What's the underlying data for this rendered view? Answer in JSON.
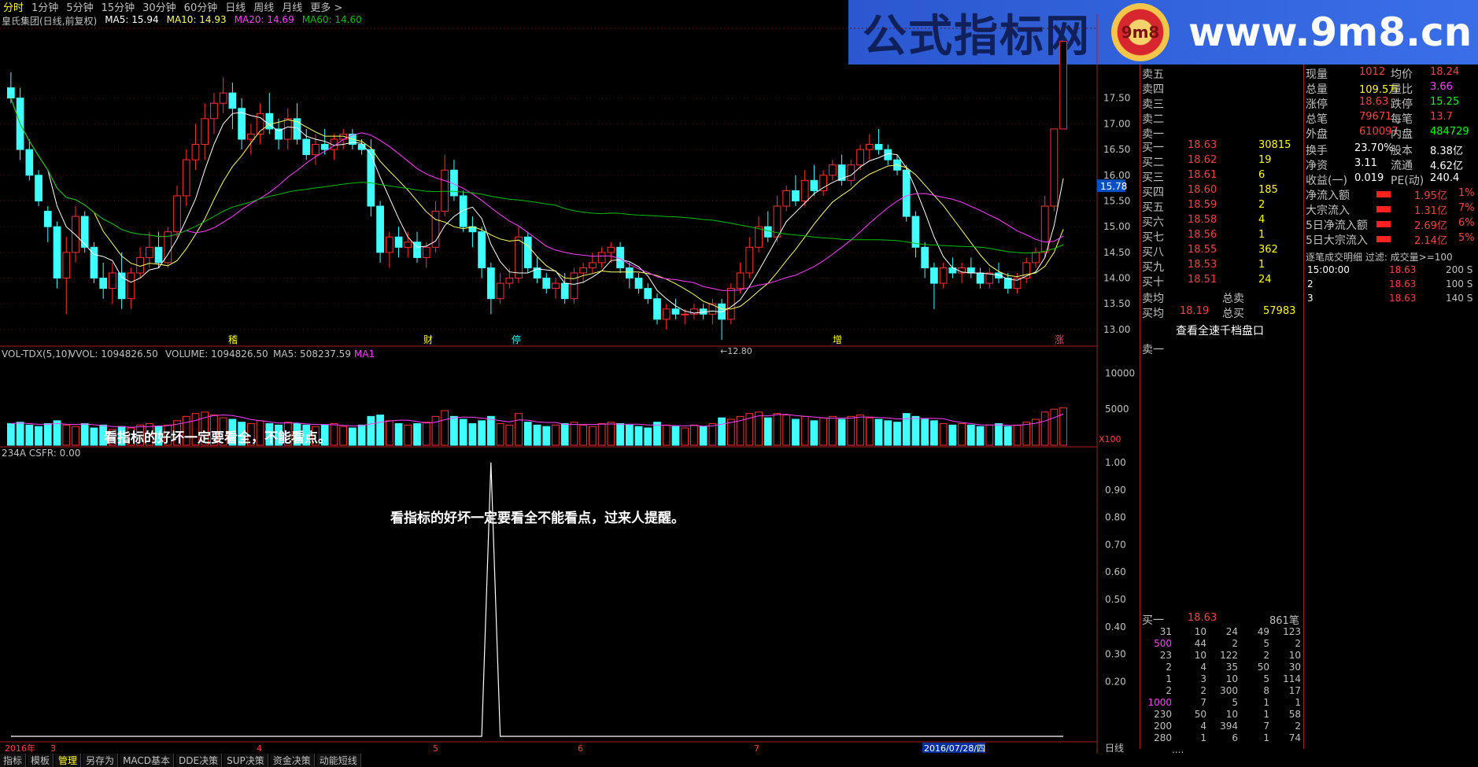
{
  "period_tabs": [
    "分时",
    "1分钟",
    "5分钟",
    "15分钟",
    "30分钟",
    "60分钟",
    "日线",
    "周线",
    "月线",
    "更多 >"
  ],
  "active_tab": "分时",
  "info": {
    "stock": "皇氏集团(日线,前复权)",
    "ma5": "MA5: 15.94",
    "ma10": "MA10: 14.93",
    "ma20": "MA20: 14.69",
    "ma60": "MA60: 14.60"
  },
  "banner": {
    "title": "公式指标网",
    "logo": "9m8",
    "url": "www.9m8.cn"
  },
  "price_axis": [
    "17.50",
    "17.00",
    "16.50",
    "16.00",
    "15.50",
    "15.00",
    "14.50",
    "14.00",
    "13.50",
    "13.00"
  ],
  "current_price_marker": "15.78",
  "low_label": "←12.80",
  "event_marks": [
    "稽",
    "财",
    "停",
    "增",
    "涨"
  ],
  "vol_header": {
    "name": "VOL-TDX(5,10)",
    "vvol": "VVOL: 1094826.50",
    "volume": "VOLUME: 1094826.50",
    "ma5": "MA5: 508237.59",
    "ma1": "MA1"
  },
  "vol_axis": [
    "10000",
    "5000"
  ],
  "vol_unit": "X100",
  "vol_note": "看指标的好坏一定要看全，不能看点。",
  "ind_header": "234A  CSFR: 0.00",
  "ind_axis": [
    "1.00",
    "0.90",
    "0.80",
    "0.70",
    "0.60",
    "0.50",
    "0.40",
    "0.30",
    "0.20"
  ],
  "ind_note": "看指标的好坏一定要看全不能看点，过来人提醒。",
  "date_bar": {
    "year": "2016年",
    "months": [
      "3",
      "4",
      "5",
      "6",
      "7"
    ],
    "highlight": "2016/07/28/四",
    "right": "日线"
  },
  "bottom_tabs": [
    "指标",
    "模板",
    "管理",
    "另存为",
    "MACD基本",
    "DDE决策",
    "SUP决策",
    "资金决策",
    "动能短线"
  ],
  "active_bottom_tab": "管理",
  "sell_levels": [
    "卖五",
    "卖四",
    "卖三",
    "卖二",
    "卖一"
  ],
  "buy_levels": [
    {
      "l": "买一",
      "p": "18.63",
      "v": "30815"
    },
    {
      "l": "买二",
      "p": "18.62",
      "v": "19"
    },
    {
      "l": "买三",
      "p": "18.61",
      "v": "6"
    },
    {
      "l": "买四",
      "p": "18.60",
      "v": "185"
    },
    {
      "l": "买五",
      "p": "18.59",
      "v": "2"
    },
    {
      "l": "买六",
      "p": "18.58",
      "v": "4"
    },
    {
      "l": "买七",
      "p": "18.56",
      "v": "1"
    },
    {
      "l": "买八",
      "p": "18.55",
      "v": "362"
    },
    {
      "l": "买九",
      "p": "18.53",
      "v": "1"
    },
    {
      "l": "买十",
      "p": "18.51",
      "v": "24"
    }
  ],
  "avg": {
    "sell_label": "卖均",
    "total_sell": "总卖",
    "buy_label": "买均",
    "buy_avg": "18.19",
    "total_buy_label": "总买",
    "total_buy": "57983"
  },
  "thousand_link": "查看全速千档盘口",
  "sell_one_label": "卖一",
  "queue_header": {
    "label": "买一",
    "price": "18.63",
    "count": "861笔"
  },
  "queue": [
    [
      "31",
      "10",
      "24",
      "49",
      "123"
    ],
    [
      "500",
      "44",
      "2",
      "5",
      "2"
    ],
    [
      "23",
      "10",
      "122",
      "2",
      "10"
    ],
    [
      "2",
      "4",
      "35",
      "50",
      "30"
    ],
    [
      "1",
      "3",
      "10",
      "5",
      "114"
    ],
    [
      "2",
      "2",
      "300",
      "8",
      "17"
    ],
    [
      "1000",
      "7",
      "5",
      "1",
      "1"
    ],
    [
      "230",
      "50",
      "10",
      "1",
      "58"
    ],
    [
      "200",
      "4",
      "394",
      "7",
      "2"
    ],
    [
      "280",
      "1",
      "6",
      "1",
      "74"
    ]
  ],
  "queue_more": "....",
  "quote": [
    {
      "a": "现量",
      "av": "1012",
      "b": "均价",
      "bv": "18.24"
    },
    {
      "a": "总量",
      "av": "109.5万",
      "b": "量比",
      "bv": "3.66"
    },
    {
      "a": "涨停",
      "av": "18.63",
      "b": "跌停",
      "bv": "15.25"
    },
    {
      "a": "总笔",
      "av": "79671",
      "b": "每笔",
      "bv": "13.7"
    },
    {
      "a": "外盘",
      "av": "610097",
      "b": "内盘",
      "bv": "484729"
    }
  ],
  "stats": [
    {
      "a": "换手",
      "av": "23.70%",
      "b": "股本",
      "bv": "8.38亿"
    },
    {
      "a": "净资",
      "av": "3.11",
      "b": "流通",
      "bv": "4.62亿"
    },
    {
      "a": "收益(一)",
      "av": "0.019",
      "b": "PE(动)",
      "bv": "240.4"
    }
  ],
  "flows": [
    {
      "l": "净流入额",
      "v": "1.95亿",
      "p": "1%"
    },
    {
      "l": "大宗流入",
      "v": "1.31亿",
      "p": "7%"
    },
    {
      "l": "5日净流入额",
      "v": "2.69亿",
      "p": "6%"
    },
    {
      "l": "5日大宗流入",
      "v": "2.14亿",
      "p": "5%"
    }
  ],
  "deals_header": "逐笔成交明细 过滤: 成交量>=100",
  "deals": [
    {
      "t": "15:00:00",
      "p": "18.63",
      "v": "200 S"
    },
    {
      "t": "2",
      "p": "18.63",
      "v": "100 S"
    },
    {
      "t": "3",
      "p": "18.63",
      "v": "140 S"
    }
  ],
  "chart_data": {
    "type": "candlestick",
    "candles": [
      [
        17.7,
        18.0,
        17.4,
        17.5
      ],
      [
        17.5,
        17.7,
        16.3,
        16.5
      ],
      [
        16.5,
        16.7,
        15.9,
        16.0
      ],
      [
        16.0,
        16.1,
        15.4,
        15.5
      ],
      [
        15.3,
        15.4,
        14.7,
        15.0
      ],
      [
        15.0,
        15.1,
        13.8,
        14.0
      ],
      [
        14.0,
        14.8,
        13.3,
        14.5
      ],
      [
        14.5,
        15.4,
        14.3,
        15.2
      ],
      [
        15.2,
        15.3,
        14.5,
        14.6
      ],
      [
        14.6,
        14.7,
        13.9,
        14.0
      ],
      [
        14.0,
        14.3,
        13.6,
        13.8
      ],
      [
        13.8,
        14.3,
        13.5,
        14.1
      ],
      [
        14.1,
        14.5,
        13.4,
        13.6
      ],
      [
        13.6,
        14.2,
        13.4,
        14.1
      ],
      [
        14.1,
        14.6,
        14.0,
        14.4
      ],
      [
        14.4,
        14.9,
        14.2,
        14.6
      ],
      [
        14.6,
        14.9,
        14.2,
        14.3
      ],
      [
        14.3,
        15.0,
        14.2,
        14.9
      ],
      [
        14.9,
        15.8,
        14.8,
        15.6
      ],
      [
        15.6,
        16.5,
        15.4,
        16.3
      ],
      [
        16.3,
        17.0,
        16.1,
        16.6
      ],
      [
        16.6,
        17.4,
        16.3,
        17.1
      ],
      [
        17.1,
        17.6,
        16.8,
        17.4
      ],
      [
        17.4,
        17.9,
        17.2,
        17.6
      ],
      [
        17.6,
        17.8,
        16.9,
        17.3
      ],
      [
        17.3,
        17.5,
        16.5,
        16.7
      ],
      [
        16.7,
        17.0,
        16.4,
        16.8
      ],
      [
        16.8,
        17.4,
        16.6,
        17.2
      ],
      [
        17.2,
        17.6,
        16.8,
        16.9
      ],
      [
        16.9,
        17.1,
        16.5,
        16.7
      ],
      [
        16.7,
        17.3,
        16.5,
        17.1
      ],
      [
        17.1,
        17.4,
        16.6,
        16.7
      ],
      [
        16.7,
        16.9,
        16.3,
        16.4
      ],
      [
        16.4,
        16.8,
        16.2,
        16.6
      ],
      [
        16.6,
        16.9,
        16.4,
        16.5
      ],
      [
        16.5,
        16.8,
        16.3,
        16.7
      ],
      [
        16.7,
        16.9,
        16.5,
        16.8
      ],
      [
        16.8,
        16.9,
        16.5,
        16.6
      ],
      [
        16.6,
        16.7,
        16.4,
        16.5
      ],
      [
        16.5,
        16.7,
        15.2,
        15.4
      ],
      [
        15.4,
        15.5,
        14.3,
        14.5
      ],
      [
        14.5,
        14.9,
        14.2,
        14.8
      ],
      [
        14.8,
        15.0,
        14.4,
        14.6
      ],
      [
        14.6,
        14.9,
        14.4,
        14.7
      ],
      [
        14.7,
        14.9,
        14.3,
        14.4
      ],
      [
        14.4,
        14.7,
        14.2,
        14.6
      ],
      [
        14.6,
        15.5,
        14.5,
        15.3
      ],
      [
        15.3,
        16.4,
        15.2,
        16.1
      ],
      [
        16.1,
        16.3,
        15.5,
        15.6
      ],
      [
        15.6,
        15.7,
        14.9,
        15.0
      ],
      [
        15.0,
        15.2,
        14.6,
        14.9
      ],
      [
        14.9,
        15.0,
        14.0,
        14.2
      ],
      [
        14.2,
        14.3,
        13.3,
        13.6
      ],
      [
        13.6,
        14.1,
        13.5,
        13.9
      ],
      [
        13.9,
        14.2,
        13.8,
        14.0
      ],
      [
        14.0,
        15.0,
        13.9,
        14.8
      ],
      [
        14.8,
        14.9,
        14.1,
        14.2
      ],
      [
        14.2,
        14.4,
        13.9,
        14.0
      ],
      [
        14.0,
        14.1,
        13.7,
        13.8
      ],
      [
        13.8,
        14.0,
        13.6,
        13.9
      ],
      [
        13.9,
        14.1,
        13.5,
        13.6
      ],
      [
        13.6,
        14.2,
        13.5,
        14.1
      ],
      [
        14.1,
        14.3,
        13.9,
        14.2
      ],
      [
        14.2,
        14.5,
        14.1,
        14.3
      ],
      [
        14.3,
        14.6,
        14.2,
        14.5
      ],
      [
        14.5,
        14.7,
        14.3,
        14.6
      ],
      [
        14.6,
        14.7,
        14.1,
        14.2
      ],
      [
        14.2,
        14.3,
        13.8,
        14.0
      ],
      [
        14.0,
        14.1,
        13.7,
        13.8
      ],
      [
        13.8,
        13.9,
        13.5,
        13.6
      ],
      [
        13.6,
        13.7,
        13.1,
        13.2
      ],
      [
        13.2,
        13.5,
        13.0,
        13.4
      ],
      [
        13.4,
        13.6,
        13.2,
        13.3
      ],
      [
        13.3,
        13.4,
        13.1,
        13.3
      ],
      [
        13.3,
        13.5,
        13.2,
        13.4
      ],
      [
        13.4,
        13.5,
        13.2,
        13.3
      ],
      [
        13.3,
        13.6,
        13.1,
        13.5
      ],
      [
        13.5,
        13.6,
        12.8,
        13.2
      ],
      [
        13.2,
        13.9,
        13.1,
        13.8
      ],
      [
        13.8,
        14.3,
        13.7,
        14.1
      ],
      [
        14.1,
        14.8,
        14.0,
        14.6
      ],
      [
        14.6,
        15.2,
        14.5,
        15.0
      ],
      [
        15.0,
        15.3,
        14.7,
        14.8
      ],
      [
        14.8,
        15.6,
        14.7,
        15.4
      ],
      [
        15.4,
        15.8,
        15.3,
        15.7
      ],
      [
        15.7,
        16.0,
        15.4,
        15.5
      ],
      [
        15.5,
        16.1,
        15.4,
        15.9
      ],
      [
        15.9,
        16.2,
        15.6,
        15.7
      ],
      [
        15.7,
        16.1,
        15.6,
        16.0
      ],
      [
        16.0,
        16.3,
        15.9,
        16.2
      ],
      [
        16.2,
        16.4,
        15.8,
        15.9
      ],
      [
        15.9,
        16.3,
        15.8,
        16.2
      ],
      [
        16.2,
        16.6,
        16.1,
        16.5
      ],
      [
        16.5,
        16.8,
        16.3,
        16.6
      ],
      [
        16.6,
        16.9,
        16.4,
        16.5
      ],
      [
        16.5,
        16.6,
        16.2,
        16.3
      ],
      [
        16.3,
        16.4,
        16.0,
        16.1
      ],
      [
        16.1,
        16.2,
        15.1,
        15.2
      ],
      [
        15.2,
        15.3,
        14.4,
        14.6
      ],
      [
        14.6,
        14.7,
        14.0,
        14.2
      ],
      [
        14.2,
        14.3,
        13.4,
        13.9
      ],
      [
        13.9,
        14.3,
        13.8,
        14.2
      ],
      [
        14.2,
        14.4,
        14.0,
        14.1
      ],
      [
        14.1,
        14.3,
        13.9,
        14.2
      ],
      [
        14.2,
        14.4,
        14.0,
        14.1
      ],
      [
        14.1,
        14.2,
        13.8,
        13.9
      ],
      [
        13.9,
        14.2,
        13.8,
        14.1
      ],
      [
        14.1,
        14.3,
        13.9,
        14.0
      ],
      [
        14.0,
        14.1,
        13.7,
        13.8
      ],
      [
        13.8,
        14.1,
        13.7,
        14.0
      ],
      [
        14.0,
        14.4,
        13.9,
        14.3
      ],
      [
        14.3,
        14.6,
        14.2,
        14.5
      ],
      [
        14.5,
        15.6,
        14.4,
        15.4
      ],
      [
        15.4,
        16.9,
        15.3,
        16.9
      ],
      [
        16.9,
        18.6,
        16.9,
        18.6
      ]
    ],
    "ma5_color": "#ffffff",
    "ma10_color": "#ffff66",
    "ma20_color": "#ff40ff",
    "ma60_color": "#00c000",
    "ylim": [
      12.8,
      18.0
    ],
    "volume": [
      30,
      32,
      28,
      26,
      30,
      34,
      28,
      26,
      30,
      24,
      28,
      22,
      26,
      24,
      28,
      30,
      26,
      28,
      34,
      40,
      44,
      46,
      42,
      38,
      36,
      32,
      30,
      34,
      30,
      28,
      32,
      30,
      28,
      26,
      28,
      30,
      26,
      24,
      28,
      40,
      42,
      34,
      30,
      28,
      30,
      32,
      40,
      48,
      40,
      36,
      30,
      34,
      40,
      30,
      28,
      44,
      32,
      28,
      26,
      28,
      30,
      32,
      28,
      26,
      30,
      32,
      30,
      28,
      26,
      24,
      32,
      28,
      26,
      24,
      28,
      26,
      30,
      38,
      36,
      40,
      44,
      46,
      38,
      44,
      42,
      36,
      40,
      34,
      38,
      40,
      36,
      40,
      42,
      38,
      36,
      34,
      32,
      44,
      40,
      36,
      34,
      30,
      28,
      30,
      28,
      26,
      28,
      30,
      26,
      28,
      32,
      36,
      46,
      50,
      52
    ],
    "indicator_spikes": [
      52,
      117
    ]
  }
}
